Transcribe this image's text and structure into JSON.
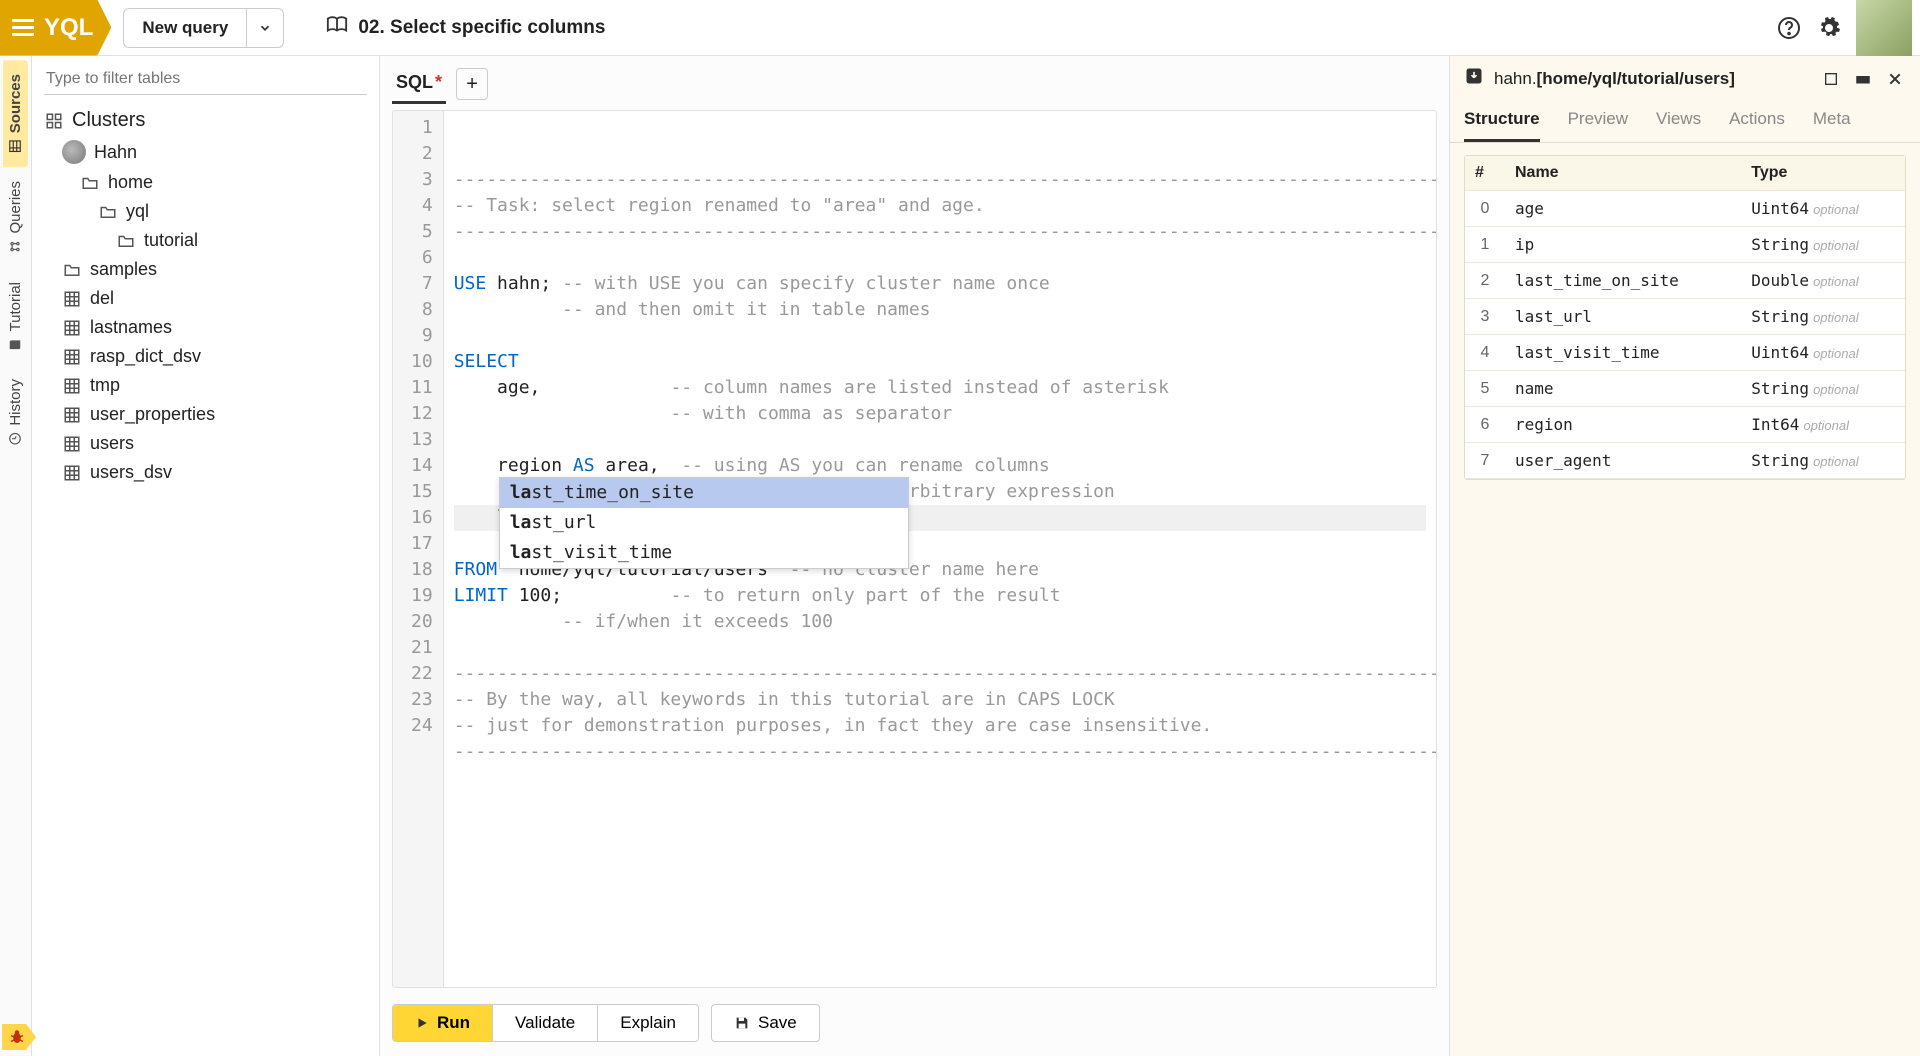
{
  "header": {
    "brand": "YQL",
    "new_query_label": "New query",
    "lesson_title": "02. Select specific columns"
  },
  "rail": {
    "tabs": [
      "Sources",
      "Queries",
      "Tutorial",
      "History"
    ],
    "active": 0
  },
  "sources": {
    "filter_placeholder": "Type to filter tables",
    "clusters_label": "Clusters",
    "cluster_name": "Hahn",
    "folders": [
      "home",
      "yql",
      "tutorial"
    ],
    "tables": [
      "samples",
      "del",
      "lastnames",
      "rasp_dict_dsv",
      "tmp",
      "user_properties",
      "users",
      "users_dsv"
    ]
  },
  "editor": {
    "tab_label": "SQL",
    "dirty_marker": "*",
    "lines": [
      {
        "type": "comment",
        "text": "---------------------------------------------------------------------------------------------------"
      },
      {
        "type": "comment",
        "text": "-- Task: select region renamed to \"area\" and age."
      },
      {
        "type": "comment",
        "text": "---------------------------------------------------------------------------------------------------"
      },
      {
        "type": "blank",
        "text": ""
      },
      {
        "type": "code",
        "text": "USE hahn; -- with USE you can specify cluster name once"
      },
      {
        "type": "comment",
        "text": "          -- and then omit it in table names"
      },
      {
        "type": "blank",
        "text": ""
      },
      {
        "type": "code",
        "text": "SELECT"
      },
      {
        "type": "code",
        "text": "    age,            -- column names are listed instead of asterisk"
      },
      {
        "type": "comment",
        "text": "                    -- with comma as separator"
      },
      {
        "type": "blank",
        "text": ""
      },
      {
        "type": "code",
        "text": "    region AS area,  -- using AS you can rename columns"
      },
      {
        "type": "comment",
        "text": "                    -- or give a name to arbitrary expression"
      },
      {
        "type": "code",
        "text": "    la"
      },
      {
        "type": "blank",
        "text": ""
      },
      {
        "type": "code",
        "text": "FROM `home/yql/tutorial/users` -- no cluster name here"
      },
      {
        "type": "code",
        "text": "LIMIT 100;          -- to return only part of the result"
      },
      {
        "type": "comment",
        "text": "          -- if/when it exceeds 100"
      },
      {
        "type": "blank",
        "text": ""
      },
      {
        "type": "comment",
        "text": "---------------------------------------------------------------------------------------------------"
      },
      {
        "type": "comment",
        "text": "-- By the way, all keywords in this tutorial are in CAPS LOCK"
      },
      {
        "type": "comment",
        "text": "-- just for demonstration purposes, in fact they are case insensitive."
      },
      {
        "type": "comment",
        "text": "---------------------------------------------------------------------------------------------------"
      },
      {
        "type": "blank",
        "text": ""
      }
    ],
    "autocomplete": {
      "prefix_bold": "la",
      "options": [
        "last_time_on_site",
        "last_url",
        "last_visit_time"
      ],
      "selected": 0
    },
    "actions": {
      "run": "Run",
      "validate": "Validate",
      "explain": "Explain",
      "save": "Save"
    }
  },
  "right": {
    "path_prefix": "hahn.",
    "path_bold": "[home/yql/tutorial/users]",
    "tabs": [
      "Structure",
      "Preview",
      "Views",
      "Actions",
      "Meta"
    ],
    "active_tab": 0,
    "schema": {
      "headers": {
        "index": "#",
        "name": "Name",
        "type": "Type"
      },
      "optional_label": "optional",
      "rows": [
        {
          "i": 0,
          "name": "age",
          "type": "Uint64"
        },
        {
          "i": 1,
          "name": "ip",
          "type": "String"
        },
        {
          "i": 2,
          "name": "last_time_on_site",
          "type": "Double"
        },
        {
          "i": 3,
          "name": "last_url",
          "type": "String"
        },
        {
          "i": 4,
          "name": "last_visit_time",
          "type": "Uint64"
        },
        {
          "i": 5,
          "name": "name",
          "type": "String"
        },
        {
          "i": 6,
          "name": "region",
          "type": "Int64"
        },
        {
          "i": 7,
          "name": "user_agent",
          "type": "String"
        }
      ]
    }
  }
}
